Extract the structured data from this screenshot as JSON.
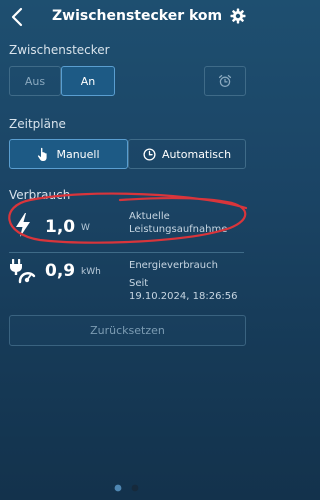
{
  "header": {
    "title": "Zwischenstecker kom…"
  },
  "plug_section": {
    "label": "Zwischenstecker",
    "off_label": "Aus",
    "on_label": "An",
    "selected": "An"
  },
  "schedule_section": {
    "label": "Zeitpläne",
    "manual_label": "Manuell",
    "auto_label": "Automatisch",
    "selected": "Manuell"
  },
  "consumption": {
    "label": "Verbrauch",
    "power": {
      "value": "1,0",
      "unit": "W",
      "description_line1": "Aktuelle",
      "description_line2": "Leistungsaufnahme"
    },
    "energy": {
      "value": "0,9",
      "unit": "kWh",
      "description_line1": "Energieverbrauch",
      "description_line2": "Seit",
      "description_line3": "19.10.2024, 18:26:56"
    },
    "reset_label": "Zurücksetzen"
  },
  "pagination": {
    "pages": 2,
    "current": 1
  },
  "colors": {
    "accent": "#5a9ed0",
    "annotation": "#d9353b"
  }
}
